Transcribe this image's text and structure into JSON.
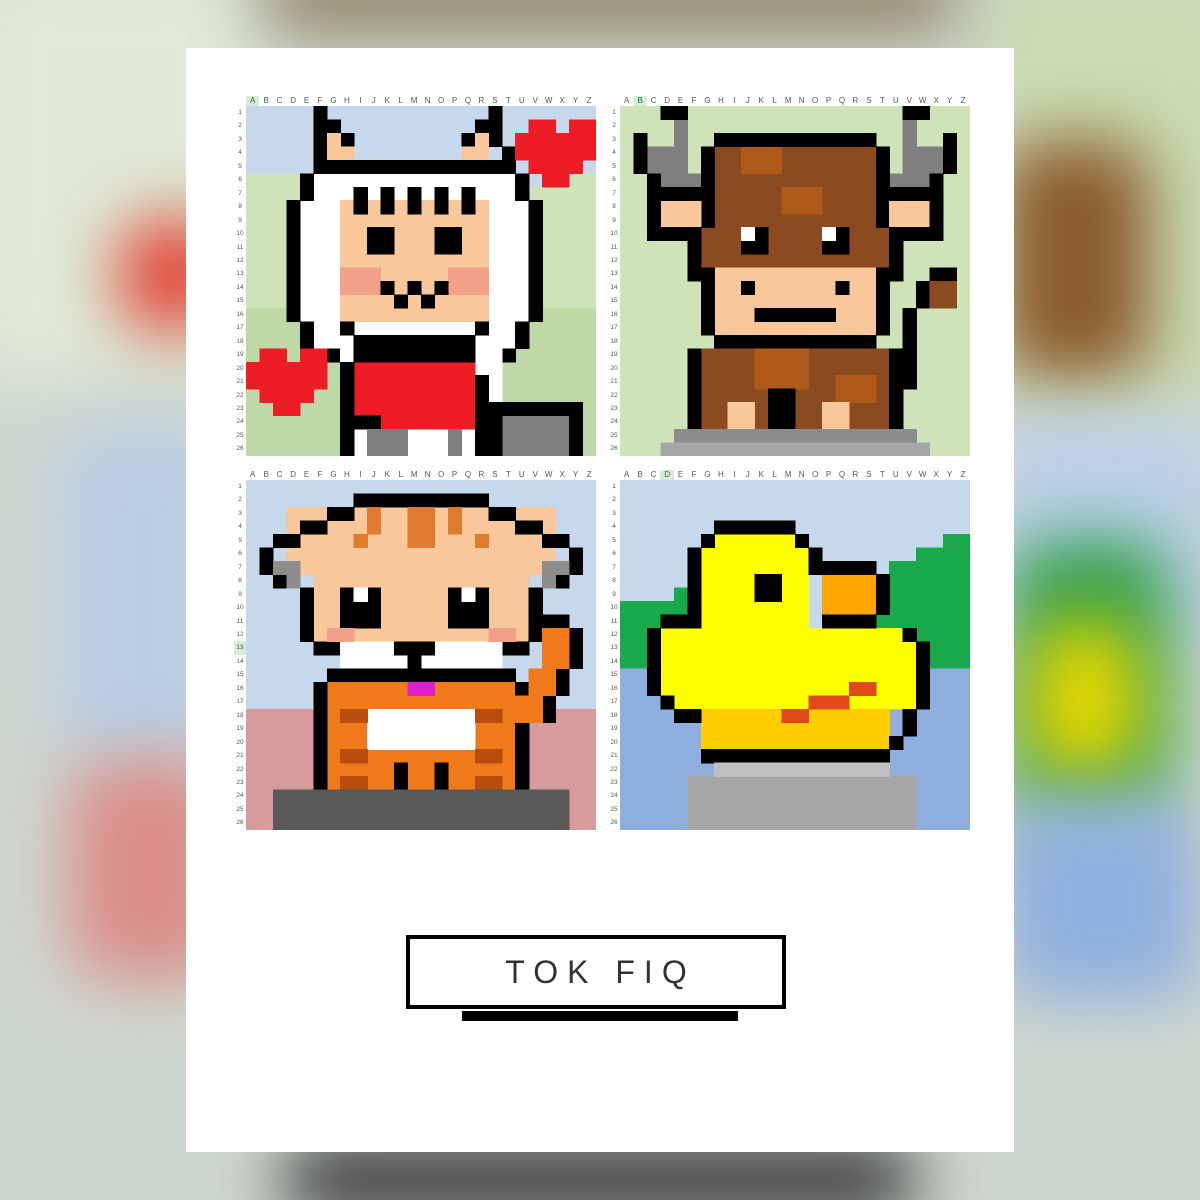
{
  "column_letters": [
    "A",
    "B",
    "C",
    "D",
    "E",
    "F",
    "G",
    "H",
    "I",
    "J",
    "K",
    "L",
    "M",
    "N",
    "O",
    "P",
    "Q",
    "R",
    "S",
    "T",
    "U",
    "V",
    "W",
    "X",
    "Y",
    "Z"
  ],
  "row_count": 26,
  "panels": [
    {
      "subject": "llama with hearts",
      "selected_column": "A",
      "selected_row": null
    },
    {
      "subject": "bull",
      "selected_column": "B",
      "selected_row": null
    },
    {
      "subject": "orange kitten",
      "selected_column": null,
      "selected_row": 13
    },
    {
      "subject": "yellow duck",
      "selected_column": "D",
      "selected_row": null
    }
  ],
  "label": {
    "text": "TOK FIQ"
  },
  "colors": {
    "card_background": "#ffffff",
    "frame_border": "#000000",
    "label_text": "#333333",
    "outline": "#000000",
    "sky_blue": "#c6d8ec",
    "meadow_green": "#cfe3b8",
    "heart_red": "#ee1c24",
    "duck_yellow": "#ffff00",
    "fur_brown": "#8b4a1f",
    "cat_orange": "#f07a1a",
    "skin": "#f8c79a"
  }
}
